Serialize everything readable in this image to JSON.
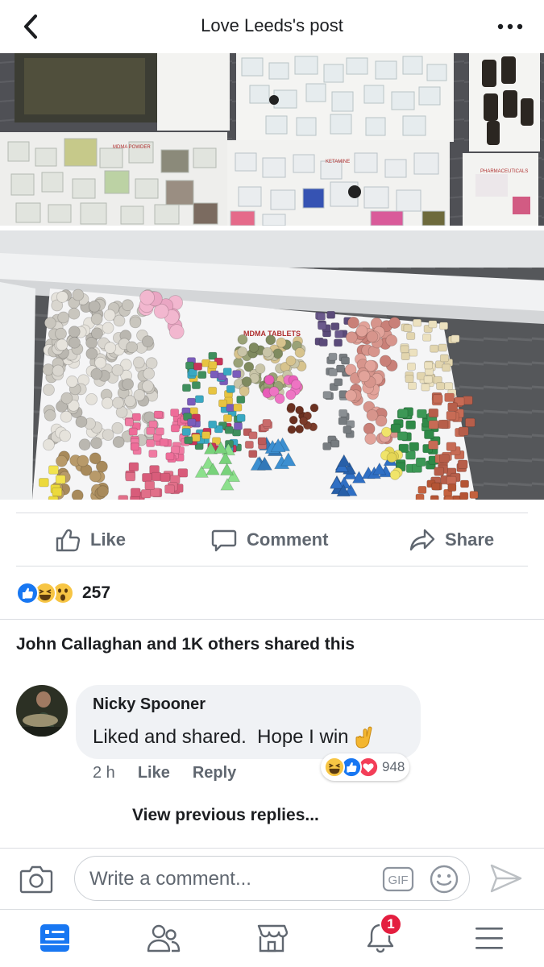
{
  "header": {
    "title": "Love Leeds's post",
    "back_icon": "chevron-left-icon",
    "more_icon": "more-dots-icon"
  },
  "photos": {
    "photo1_labels": [
      "MDMA POWDER",
      "KETAMINE",
      "PHARMACEUTICALS"
    ],
    "photo2_label": "MDMA TABLETS"
  },
  "actions": {
    "like_label": "Like",
    "comment_label": "Comment",
    "share_label": "Share"
  },
  "reactions": {
    "count": "257",
    "types": [
      "like",
      "haha",
      "wow"
    ]
  },
  "shares": {
    "text": "John Callaghan and 1K others shared this"
  },
  "comment": {
    "author": "Nicky Spooner",
    "text": "Liked and shared.  Hope I win",
    "emoji": "crossed-fingers",
    "time": "2 h",
    "like_label": "Like",
    "reply_label": "Reply",
    "reaction_count": "948",
    "reaction_types": [
      "haha",
      "like",
      "love"
    ]
  },
  "view_previous": "View previous replies...",
  "composer": {
    "placeholder": "Write a comment...",
    "gif_label": "GIF"
  },
  "nav": {
    "items": [
      "news-feed",
      "friends",
      "marketplace",
      "notifications",
      "menu"
    ],
    "notifications_badge": "1"
  },
  "colors": {
    "accent": "#1877f2",
    "text_secondary": "#606770",
    "badge": "#e41e3f"
  }
}
